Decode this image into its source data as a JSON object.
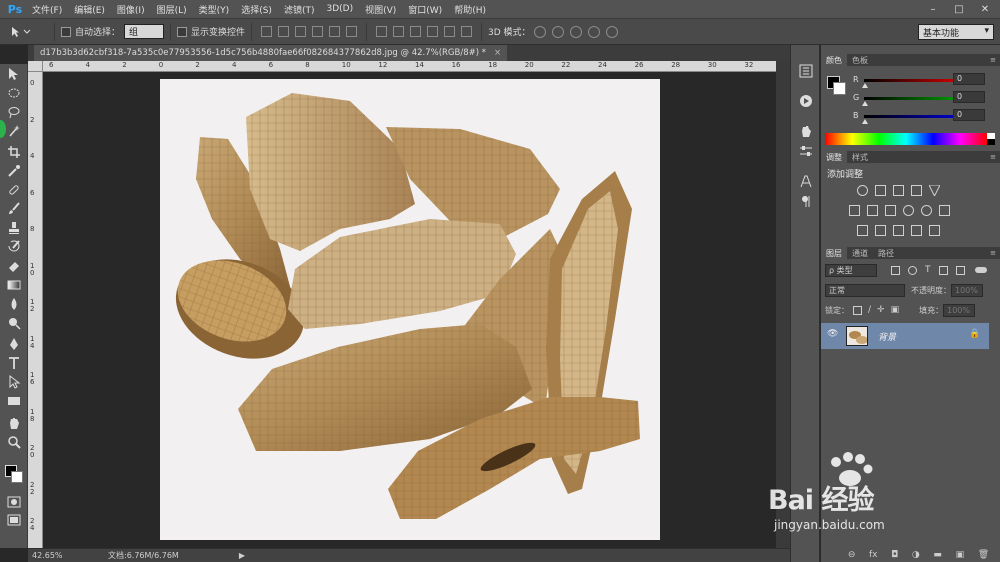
{
  "app": {
    "logo": "Ps",
    "menu": [
      "文件(F)",
      "编辑(E)",
      "图像(I)",
      "图层(L)",
      "类型(Y)",
      "选择(S)",
      "滤镜(T)",
      "3D(D)",
      "视图(V)",
      "窗口(W)",
      "帮助(H)"
    ]
  },
  "window_controls": [
    "–",
    "□",
    "✕"
  ],
  "options_bar": {
    "auto_select_label": "自动选择：",
    "auto_select_value": "组",
    "show_transform_label": "显示变换控件",
    "mode3d_label": "3D 模式：",
    "workspace": "基本功能"
  },
  "document": {
    "tab_title": "d17b3b3d62cbf318-7a535c0e77953556-1d5c756b4880fae66f082684377862d8.jpg @ 42.7%(RGB/8#) *",
    "tab_close": "×"
  },
  "rulers": {
    "top": [
      "6",
      "4",
      "2",
      "0",
      "2",
      "4",
      "6",
      "8",
      "10",
      "12",
      "14",
      "16",
      "18",
      "20",
      "22",
      "24",
      "26",
      "28",
      "30",
      "32"
    ],
    "left": [
      "0",
      "2",
      "4",
      "6",
      "8",
      "1\n0",
      "1\n2",
      "1\n4",
      "1\n6",
      "1\n8",
      "2\n0",
      "2\n2",
      "2\n4"
    ]
  },
  "status": {
    "zoom": "42.65%",
    "doc_size": "文档:6.76M/6.76M",
    "arrow": "▶"
  },
  "color_panel": {
    "tabs": [
      "颜色",
      "色板"
    ],
    "r_label": "R",
    "r_value": "0",
    "g_label": "G",
    "g_value": "0",
    "b_label": "B",
    "b_value": "0",
    "slider_colors": {
      "r": "#ff0000",
      "g": "#00c000",
      "b": "#0000ff"
    }
  },
  "adjustments_panel": {
    "tabs": [
      "调整",
      "样式"
    ],
    "title": "添加调整"
  },
  "layers_panel": {
    "tabs": [
      "图层",
      "通道",
      "路径"
    ],
    "filter_label": "ρ 类型",
    "blend_mode": "正常",
    "opacity_label": "不透明度：",
    "opacity_value": "100%",
    "lock_label": "锁定：",
    "fill_label": "填充：",
    "fill_value": "100%",
    "layer_name": "背景",
    "bottom_icons": [
      "⊖",
      "fx",
      "◘",
      "◑",
      "▬",
      "▣",
      "🗑"
    ]
  },
  "watermark": {
    "brand": "Bai 经验",
    "url": "jingyan.baidu.com"
  },
  "colors": {
    "selected_layer": "#6f87a8",
    "panel_bg": "#535353",
    "canvas_bg": "#282828",
    "document_bg": "#f3f0f1"
  }
}
